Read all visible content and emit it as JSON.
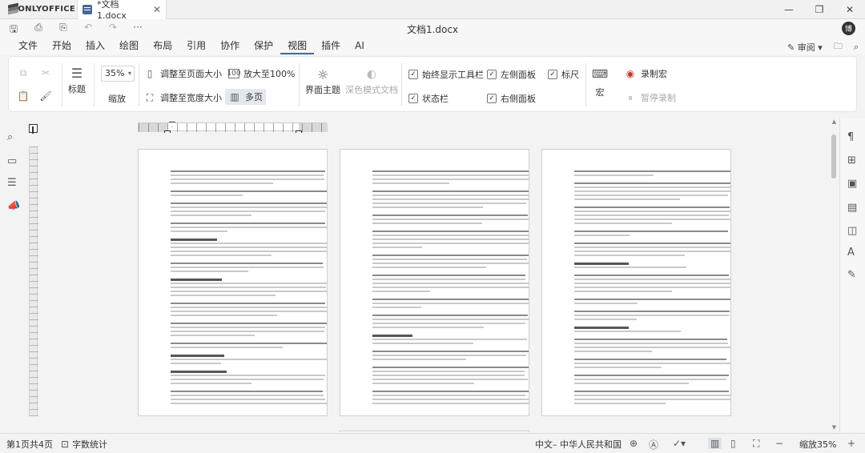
{
  "app": {
    "brand": "ONLYOFFICE",
    "tab_title": "*文档1.docx",
    "doc_title": "文档1.docx",
    "avatar_initial": "博"
  },
  "menu": {
    "items": [
      "文件",
      "开始",
      "插入",
      "绘图",
      "布局",
      "引用",
      "协作",
      "保护",
      "视图",
      "插件",
      "AI"
    ],
    "active": "视图",
    "review_label": "审阅"
  },
  "toolbar": {
    "heading_label": "标题",
    "zoom_value": "35%",
    "zoom_label": "缩放",
    "fit_page": "调整至页面大小",
    "fit_width": "调整至宽度大小",
    "zoom_100": "放大至100%",
    "multipage": "多页",
    "theme_label": "界面主题",
    "dark_doc": "深色模式文档",
    "always_toolbar": "始终显示工具栏",
    "status_bar": "状态栏",
    "left_panel": "左侧面板",
    "right_panel": "右侧面板",
    "ruler": "标尺",
    "macro_label": "宏",
    "record_macro": "录制宏",
    "pause_record": "暂停录制"
  },
  "statusbar": {
    "page_info": "第1页共4页",
    "word_count": "字数统计",
    "language": "中文– 中华人民共和国",
    "zoom": "缩放35%"
  },
  "pages": [
    {
      "paragraphs": 14
    },
    {
      "paragraphs": 14
    },
    {
      "paragraphs": 14
    }
  ],
  "colors": {
    "accent": "#446995",
    "background": "#f3f3f3",
    "macro_red": "#c0392b"
  }
}
